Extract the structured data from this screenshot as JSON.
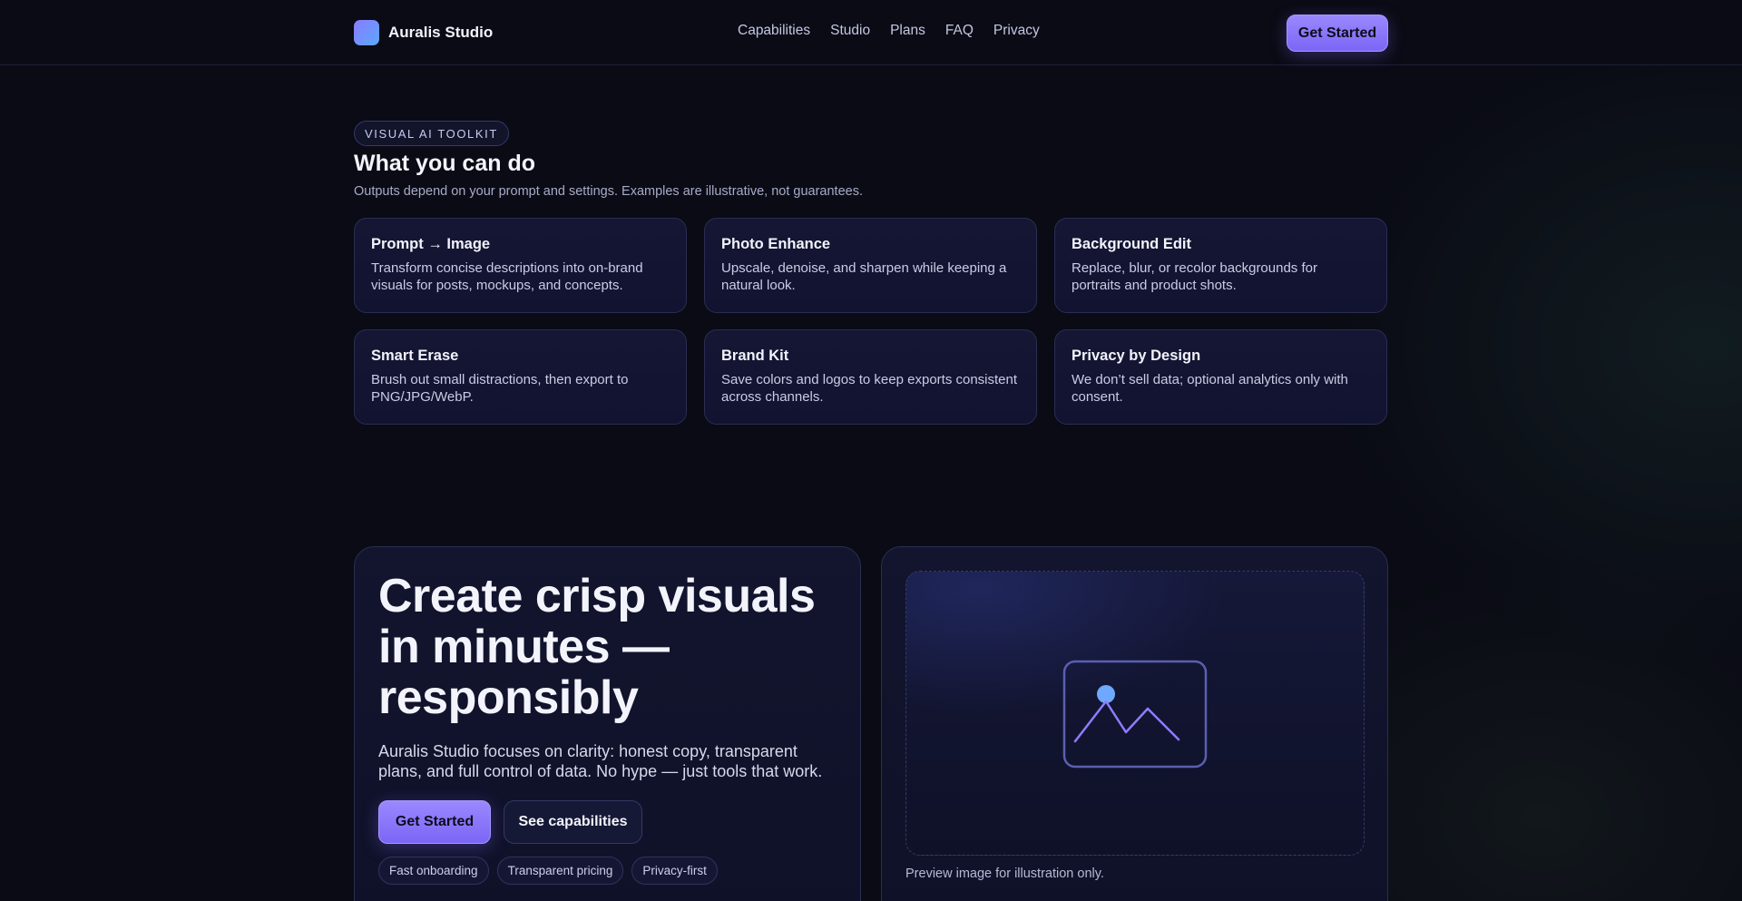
{
  "header": {
    "brand": "Auralis Studio",
    "nav": [
      "Capabilities",
      "Studio",
      "Plans",
      "FAQ",
      "Privacy"
    ],
    "cta": "Get Started"
  },
  "capabilities": {
    "badge": "VISUAL AI TOOLKIT",
    "title": "What you can do",
    "subtitle": "Outputs depend on your prompt and settings. Examples are illustrative, not guarantees.",
    "cards": [
      {
        "title": "Prompt → Image",
        "desc": "Transform concise descriptions into on-brand visuals for posts, mockups, and concepts."
      },
      {
        "title": "Photo Enhance",
        "desc": "Upscale, denoise, and sharpen while keeping a natural look."
      },
      {
        "title": "Background Edit",
        "desc": "Replace, blur, or recolor backgrounds for portraits and product shots."
      },
      {
        "title": "Smart Erase",
        "desc": "Brush out small distractions, then export to PNG/JPG/WebP."
      },
      {
        "title": "Brand Kit",
        "desc": "Save colors and logos to keep exports consistent across channels."
      },
      {
        "title": "Privacy by Design",
        "desc": "We don’t sell data; optional analytics only with consent."
      }
    ]
  },
  "hero": {
    "title": "Create crisp visuals in minutes — responsibly",
    "text": "Auralis Studio focuses on clarity: honest copy, transparent plans, and full control of data. No hype — just tools that work.",
    "primary_cta": "Get Started",
    "secondary_cta": "See capabilities",
    "chips": [
      "Fast onboarding",
      "Transparent pricing",
      "Privacy-first"
    ],
    "preview_caption": "Preview image for illustration only.",
    "preview_icon": "image-icon"
  },
  "colors": {
    "accent": "#8b78fb",
    "background": "#0a0b14",
    "card": "#141634"
  }
}
